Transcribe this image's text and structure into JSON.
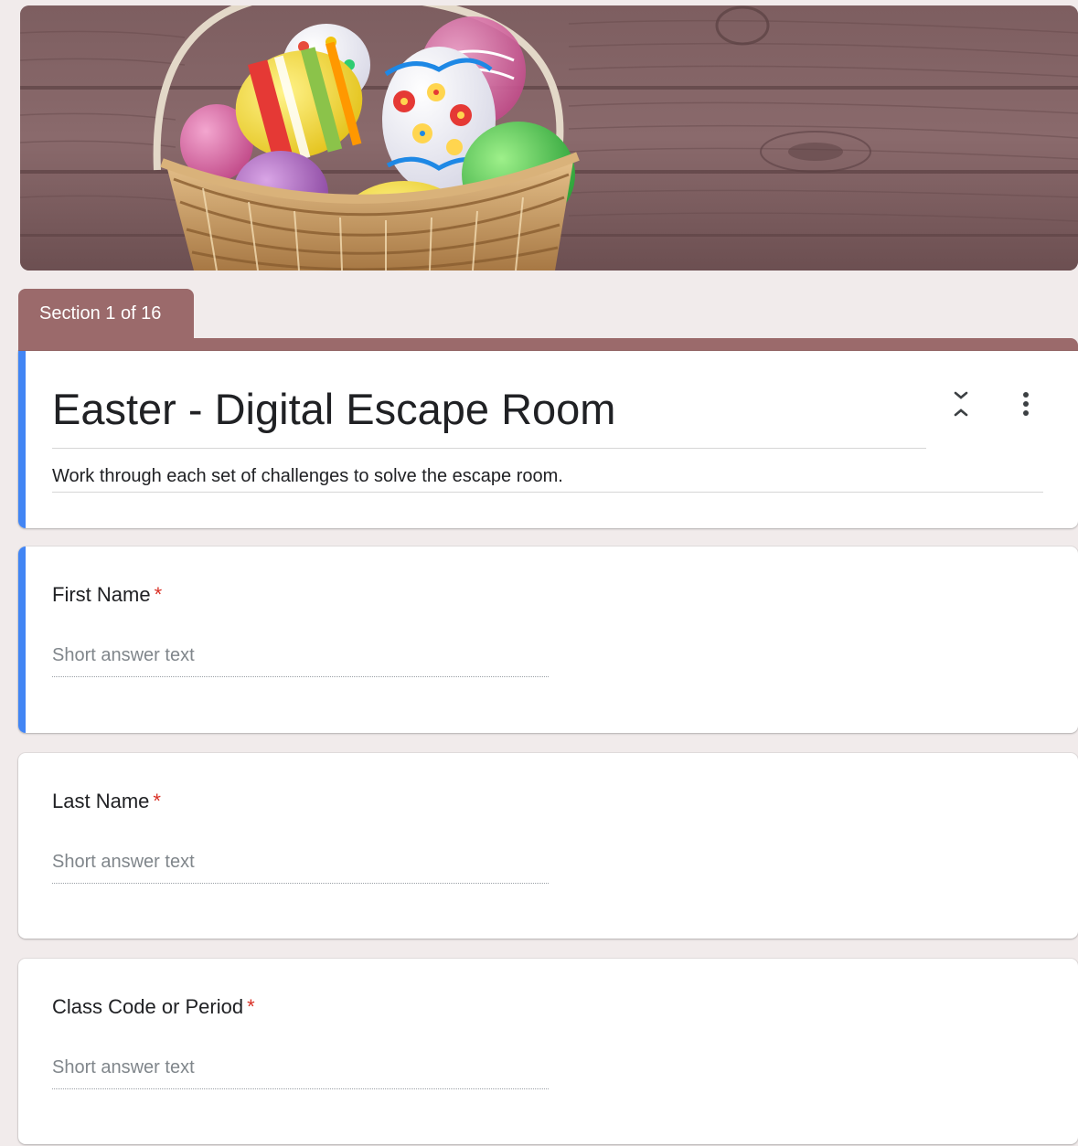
{
  "header": {
    "image": "easter-egg-basket-on-wood"
  },
  "section_tab": {
    "label": "Section 1 of 16"
  },
  "form": {
    "title": "Easter - Digital Escape Room",
    "description": "Work through each set of challenges to solve the escape room.",
    "collapse_icon": "collapse-section-icon",
    "more_icon": "more-vert-icon"
  },
  "questions": [
    {
      "label": "First Name",
      "required_mark": "*",
      "placeholder": "Short answer text"
    },
    {
      "label": "Last Name",
      "required_mark": "*",
      "placeholder": "Short answer text"
    },
    {
      "label": "Class Code or Period",
      "required_mark": "*",
      "placeholder": "Short answer text"
    }
  ],
  "colors": {
    "theme": "#9b6a6b",
    "active_bar": "#4285f4",
    "required": "#d93025",
    "background": "#f1ebeb"
  }
}
